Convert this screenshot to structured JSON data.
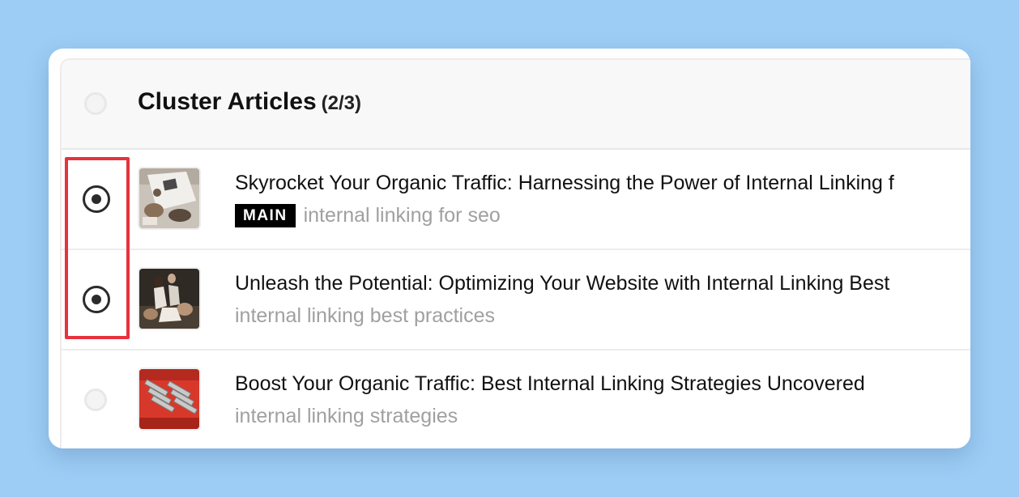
{
  "header": {
    "title": "Cluster Articles",
    "count": "(2/3)",
    "select_all_checked": false
  },
  "articles": [
    {
      "title": "Skyrocket Your Organic Traffic: Harnessing the Power of Internal Linking f",
      "badge": "MAIN",
      "keyword": "internal linking for seo",
      "selected": true,
      "thumb_icon": "desk-photo"
    },
    {
      "title": "Unleash the Potential: Optimizing Your Website with Internal Linking Best",
      "badge": "",
      "keyword": "internal linking best practices",
      "selected": true,
      "thumb_icon": "people-photo"
    },
    {
      "title": "Boost Your Organic Traffic: Best Internal Linking Strategies Uncovered",
      "badge": "",
      "keyword": "internal linking strategies",
      "selected": false,
      "thumb_icon": "spools-photo"
    }
  ],
  "colors": {
    "background": "#9dcdf5",
    "highlight": "#e8323c",
    "badge_bg": "#000000",
    "keyword_text": "#a0a0a0"
  }
}
